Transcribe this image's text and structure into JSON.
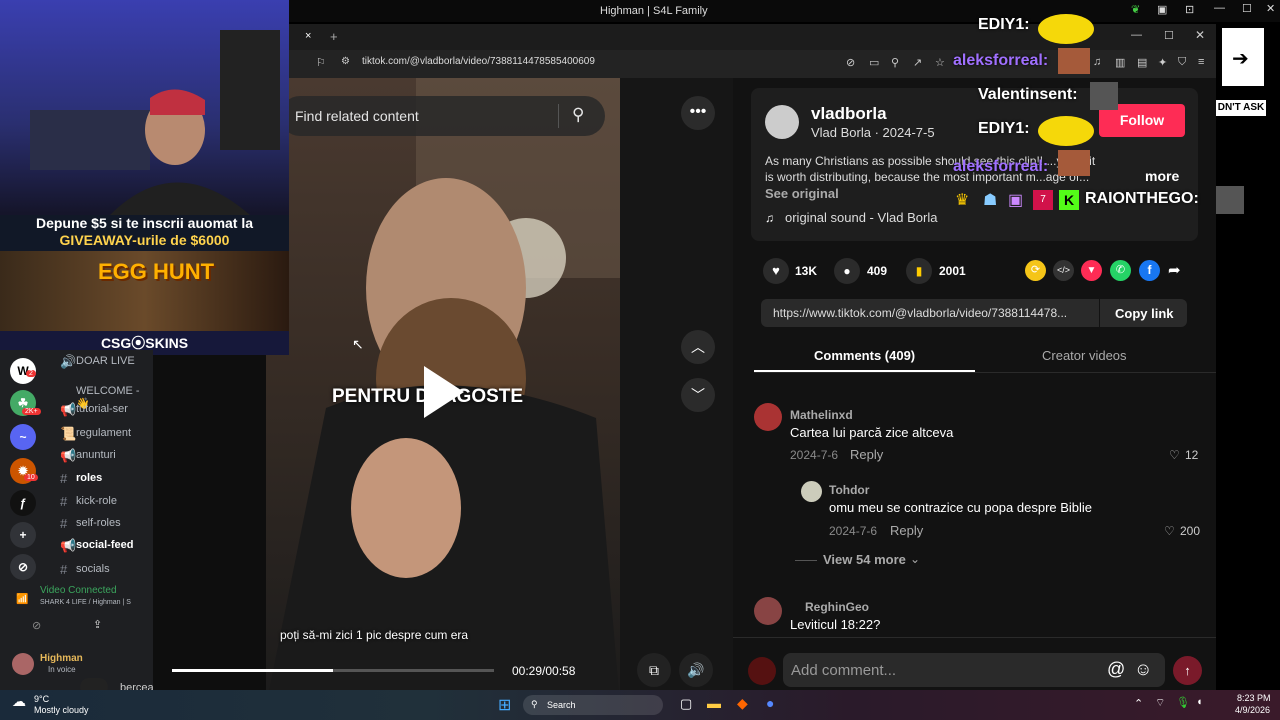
{
  "window": {
    "title": "Highman | S4L Family"
  },
  "browser": {
    "url": "tiktok.com/@vladborla/video/7388114478585400609",
    "tab_close": "×",
    "new_tab": "+"
  },
  "stream": {
    "banner_line1": "Depune $5 si te inscrii auomat la",
    "banner_line2": "GIVEAWAY-urile de $6000",
    "egg_hunt": "EGG HUNT",
    "sponsor": "CSG⦿SKINS"
  },
  "discord": {
    "channels": [
      {
        "icon": "🔊",
        "name": "DOAR LIVE",
        "bold": false
      },
      {
        "icon": "",
        "name": "WELCOME - 👋",
        "bold": false
      },
      {
        "icon": "📢",
        "name": "tutorial-ser",
        "bold": false
      },
      {
        "icon": "📜",
        "name": "regulament",
        "bold": false
      },
      {
        "icon": "📢",
        "name": "anunturi",
        "bold": false
      },
      {
        "icon": "#",
        "name": "roles",
        "bold": true
      },
      {
        "icon": "#",
        "name": "kick-role",
        "bold": false
      },
      {
        "icon": "#",
        "name": "self-roles",
        "bold": false
      },
      {
        "icon": "📢",
        "name": "social-feed",
        "bold": true
      },
      {
        "icon": "#",
        "name": "socials",
        "bold": false
      }
    ],
    "voice_status": "Video Connected",
    "voice_channel": "SHARK 4 LIFE / Highman | S",
    "user_name": "Highman",
    "user_status": "In voice",
    "badges": [
      "2",
      "2K+",
      "10"
    ]
  },
  "video": {
    "search_placeholder": "Find related content",
    "overlay_text": "PENTRU DRAGOSTE",
    "subtitle": "poți să-mi zici 1 pic despre cum era",
    "time": "00:29/00:58",
    "progress": 0.5
  },
  "post": {
    "username": "vladborla",
    "display": "Vlad Borla · 2024-7-5",
    "follow": "Follow",
    "caption_line1": "As many Christians as possible should see this clip!! ...y that it",
    "caption_line2": "is worth distributing, because the most important m...age of...",
    "more": "more",
    "see_original": "See original",
    "sound": "original sound - Vlad Borla",
    "likes": "13K",
    "comments": "409",
    "saves": "2001",
    "link": "https://www.tiktok.com/@vladborla/video/7388114478...",
    "copy_link": "Copy link",
    "tab_comments": "Comments (409)",
    "tab_creator": "Creator videos"
  },
  "comments": [
    {
      "name": "Mathelinxd",
      "text": "Cartea lui parcă zice altceva",
      "date": "2024-7-6",
      "reply": "Reply",
      "likes": "12"
    },
    {
      "name": "Tohdor",
      "text": "omu meu se contrazice cu popa despre Biblie",
      "date": "2024-7-6",
      "reply": "Reply",
      "likes": "200"
    },
    {
      "name": "ReghinGeo",
      "text": "Leviticul 18:22?",
      "date": "",
      "reply": "",
      "likes": ""
    }
  ],
  "view_more": "View 54 more",
  "add_comment": "Add comment...",
  "chat": [
    {
      "user": "EDIY1:",
      "color": "#ffffff"
    },
    {
      "user": "aleksforreal:",
      "color": "#a070ff"
    },
    {
      "user": "Valentinsent:",
      "color": "#ffffff"
    },
    {
      "user": "EDIY1:",
      "color": "#ffffff"
    },
    {
      "user": "aleksforreal:",
      "color": "#a070ff"
    },
    {
      "user": "RAIONTHEGO:",
      "color": "#ffffff"
    }
  ],
  "sign_text": "DN'T ASK",
  "taskbar": {
    "weather_temp": "9°C",
    "weather_desc": "Mostly cloudy",
    "search": "Search",
    "time": "8:23 PM",
    "date": "4/9/2026",
    "partial": "bercea"
  },
  "colors": {
    "accent": "#fe2c55",
    "bg": "#121212"
  }
}
